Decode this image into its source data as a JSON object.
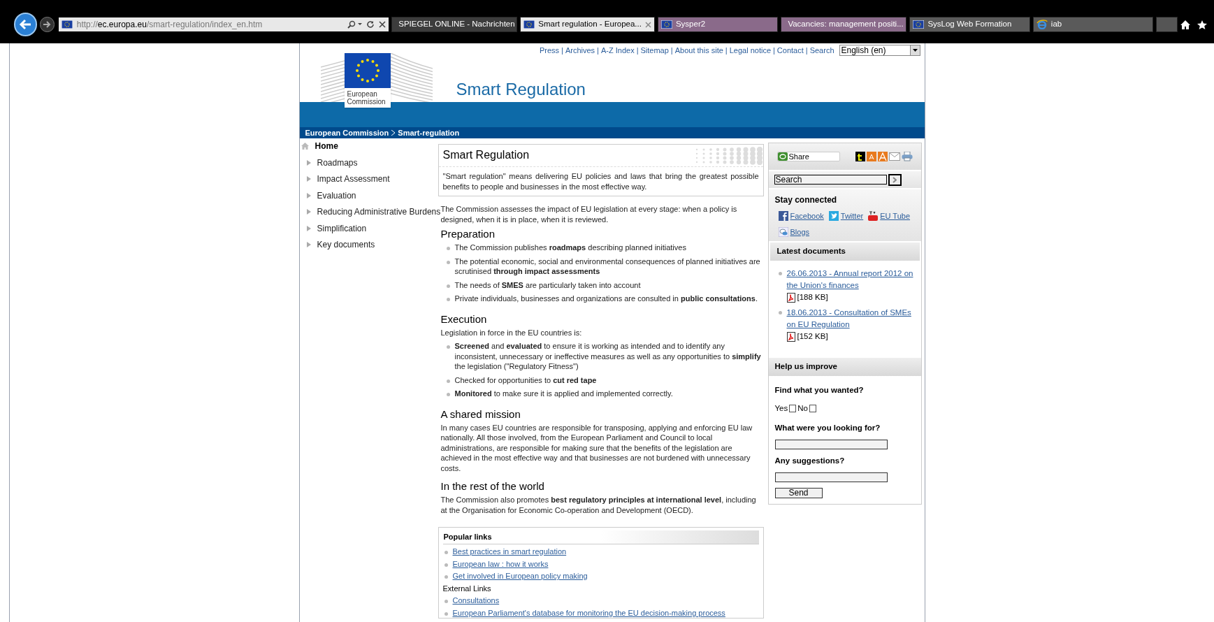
{
  "browser": {
    "url": {
      "scheme": "http://",
      "host": "ec.europa.eu",
      "path": "/smart-regulation/index_en.htm"
    },
    "tabs": [
      {
        "title": "SPIEGEL ONLINE - Nachrichten",
        "selected": false,
        "color": "#3c3c3c",
        "kind": "spiegel"
      },
      {
        "title": "Smart regulation - Europea...",
        "selected": true,
        "color": "#e8e8e8",
        "kind": "eu"
      },
      {
        "title": "Sysper2",
        "selected": false,
        "color": "#8a6a8a",
        "kind": "eu"
      },
      {
        "title": "Vacancies: management positi...",
        "selected": false,
        "color": "#8a6a8a",
        "kind": "eu"
      },
      {
        "title": "SysLog Web Formation",
        "selected": false,
        "color": "#5a5a5a",
        "kind": "eu"
      },
      {
        "title": "iab",
        "selected": false,
        "color": "#5a5a5a",
        "kind": "ie"
      }
    ]
  },
  "header": {
    "links": [
      "Press",
      "Archives",
      "A-Z Index",
      "Sitemap",
      "About this site",
      "Legal notice",
      "Contact",
      "Search"
    ],
    "separator": "|",
    "language": "English (en)",
    "logo_text": "European Commission",
    "site_title": "Smart Regulation",
    "breadcrumb": [
      "European Commission",
      "Smart-regulation"
    ]
  },
  "nav": [
    {
      "label": "Home",
      "selected": true
    },
    {
      "label": "Roadmaps",
      "selected": false
    },
    {
      "label": "Impact Assessment",
      "selected": false
    },
    {
      "label": "Evaluation",
      "selected": false
    },
    {
      "label": "Reducing Administrative Burdens",
      "selected": false
    },
    {
      "label": "Simplification",
      "selected": false
    },
    {
      "label": "Key documents",
      "selected": false
    }
  ],
  "intro_box": {
    "title": "Smart Regulation",
    "text": "\"Smart regulation\" means delivering EU policies and laws that bring the greatest possible benefits to people and businesses in the most effective way."
  },
  "intro": "The Commission assesses the impact of EU legislation at every stage: when a policy is designed, when it is in place, when it is reviewed.",
  "sections": [
    {
      "heading": "Preparation",
      "blocks": [
        {
          "kind": "list",
          "items": [
            "The Commission publishes **roadmaps** describing planned initiatives",
            "The potential economic, social and environmental consequences of planned initiatives are scrutinised **through impact assessments**",
            "The needs of **SMES** are particularly taken into account",
            "Private individuals, businesses and organizations are consulted in **public consultations**."
          ]
        }
      ]
    },
    {
      "heading": "Execution",
      "blocks": [
        {
          "kind": "para",
          "text": "Legislation in force in the EU countries is:"
        },
        {
          "kind": "list",
          "items": [
            "**Screened** and **evaluated** to ensure it is working as intended and to identify any inconsistent, unnecessary or ineffective measures as well as any opportunities to **simplify** the legislation (\"Regulatory Fitness\")",
            "Checked for opportunities to **cut red tape**",
            "**Monitored** to make sure it is applied and implemented correctly."
          ]
        }
      ]
    },
    {
      "heading": "A shared mission",
      "blocks": [
        {
          "kind": "para",
          "text": "In many cases EU countries are responsible for transposing, applying and enforcing EU law nationally. All those involved, from the European Parliament and Council to local administrations, are responsible for making sure that the benefits of the legislation are achieved in the most effective way and that businesses are not burdened with unnecessary costs."
        }
      ]
    },
    {
      "heading": "In the rest of the world",
      "blocks": [
        {
          "kind": "para",
          "text": "The Commission also promotes **best regulatory principles at international level**, including at the Organisation for Economic Co-operation and Development (OECD)."
        }
      ]
    }
  ],
  "popular_links": {
    "title": "Popular links",
    "items": [
      {
        "kind": "link",
        "text": "Best practices in smart regulation"
      },
      {
        "kind": "link",
        "text": "European law : how it works"
      },
      {
        "kind": "link",
        "text": "Get involved in European policy making"
      },
      {
        "kind": "label",
        "text": "External Links"
      },
      {
        "kind": "link",
        "text": "Consultations"
      },
      {
        "kind": "link",
        "text": "European Parliament's database for monitoring the EU decision-making process"
      }
    ]
  },
  "sidebar": {
    "share": "Share",
    "search": {
      "placeholder": "Search"
    },
    "stay_connected": {
      "title": "Stay connected",
      "links": [
        {
          "kind": "facebook",
          "text": "Facebook"
        },
        {
          "kind": "twitter",
          "text": "Twitter"
        },
        {
          "kind": "youtube",
          "text": "EU Tube"
        },
        {
          "kind": "blog",
          "text": "Blogs"
        }
      ]
    },
    "latest": {
      "title": "Latest documents",
      "items": [
        {
          "link": "26.06.2013 - Annual report 2012 on the Union's finances",
          "size": "[188 KB]"
        },
        {
          "link": "18.06.2013 - Consultation of SMEs on EU Regulation",
          "size": "[152 KB]"
        }
      ]
    },
    "help": {
      "title": "Help us improve",
      "question": "Find what you wanted?",
      "options": [
        {
          "label": "Yes",
          "checked": false
        },
        {
          "label": "No",
          "checked": false
        }
      ],
      "fields": [
        {
          "label": "What were you looking for?"
        },
        {
          "label": "Any suggestions?"
        }
      ],
      "button": "Send"
    }
  }
}
